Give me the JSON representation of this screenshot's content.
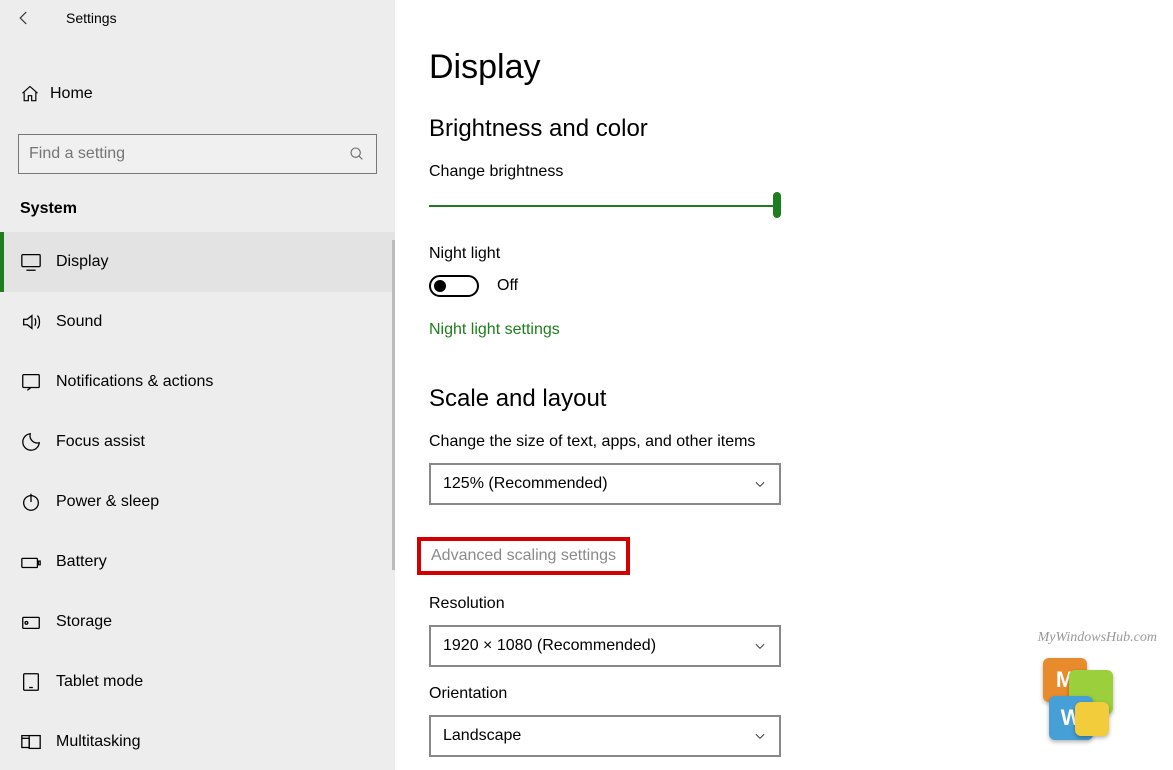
{
  "window": {
    "title": "Settings"
  },
  "sidebar": {
    "home": "Home",
    "search_placeholder": "Find a setting",
    "category": "System",
    "items": [
      {
        "label": "Display",
        "active": true
      },
      {
        "label": "Sound"
      },
      {
        "label": "Notifications & actions"
      },
      {
        "label": "Focus assist"
      },
      {
        "label": "Power & sleep"
      },
      {
        "label": "Battery"
      },
      {
        "label": "Storage"
      },
      {
        "label": "Tablet mode"
      },
      {
        "label": "Multitasking"
      }
    ]
  },
  "main": {
    "title": "Display",
    "brightness_section": "Brightness and color",
    "brightness_label": "Change brightness",
    "brightness_value_percent": 100,
    "night_light_label": "Night light",
    "night_light_state": "Off",
    "night_light_link": "Night light settings",
    "scale_section": "Scale and layout",
    "scale_label": "Change the size of text, apps, and other items",
    "scale_value": "125% (Recommended)",
    "advanced_scaling": "Advanced scaling settings",
    "resolution_label": "Resolution",
    "resolution_value": "1920 × 1080 (Recommended)",
    "orientation_label": "Orientation",
    "orientation_value": "Landscape"
  },
  "watermark": {
    "text": "MyWindowsHub.com",
    "logo_letters": {
      "top": "M",
      "bottom": "W"
    }
  },
  "colors": {
    "accent": "#1e7e1e",
    "highlight": "#d40000"
  }
}
